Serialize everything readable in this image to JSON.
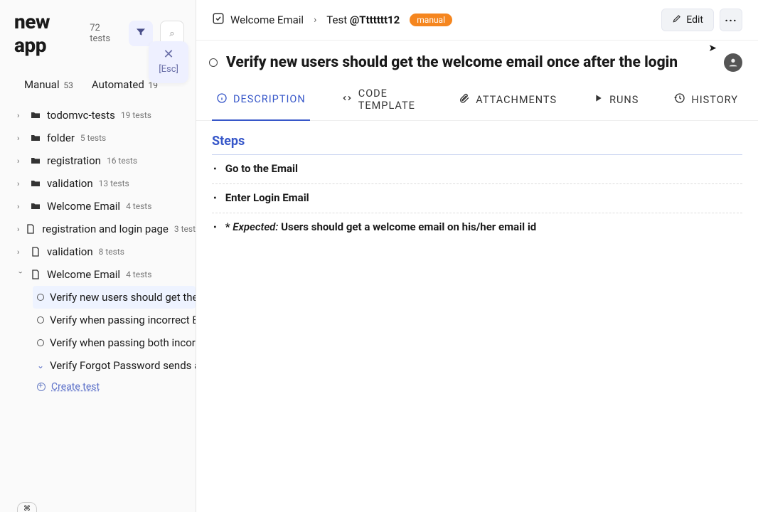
{
  "app": {
    "title": "new app",
    "total_tests_label": "72 tests"
  },
  "esc_popup": {
    "x": "✕",
    "label": "[Esc]"
  },
  "sidebar_tabs": {
    "manual": {
      "label": "Manual",
      "count": "53"
    },
    "automated": {
      "label": "Automated",
      "count": "19"
    }
  },
  "tree": {
    "items": [
      {
        "type": "folder",
        "label": "todomvc-tests",
        "count": "19 tests"
      },
      {
        "type": "folder",
        "label": "folder",
        "count": "5 tests"
      },
      {
        "type": "folder",
        "label": "registration",
        "count": "16 tests"
      },
      {
        "type": "folder",
        "label": "validation",
        "count": "13 tests"
      },
      {
        "type": "folder",
        "label": "Welcome Email",
        "count": "4 tests"
      },
      {
        "type": "file",
        "label": "registration and login page",
        "count": "3 test"
      },
      {
        "type": "file",
        "label": "validation",
        "count": "8 tests"
      },
      {
        "type": "file",
        "label": "Welcome Email",
        "count": "4 tests",
        "expanded": true
      }
    ],
    "subtests": [
      {
        "label": "Verify new users should get the",
        "active": true
      },
      {
        "label": "Verify when passing incorrect Em"
      },
      {
        "label": "Verify when passing both incorr"
      },
      {
        "label": "Verify Forgot Password sends a ",
        "caret": true
      }
    ],
    "create_label": "Create test"
  },
  "breadcrumb": {
    "parent": "Welcome Email",
    "test_prefix": "Test ",
    "test_id": "@Ttttttt12",
    "badge": "manual"
  },
  "buttons": {
    "edit": "Edit",
    "more": "···"
  },
  "title": "Verify new users should get the welcome email once after the login",
  "tabs": {
    "description": "DESCRIPTION",
    "code": "CODE TEMPLATE",
    "attachments": "ATTACHMENTS",
    "runs": "RUNS",
    "history": "HISTORY"
  },
  "steps": {
    "heading": "Steps",
    "items": [
      {
        "text": "Go to the Email"
      },
      {
        "text": "Enter Login Email"
      },
      {
        "expected_prefix": "* ",
        "expected_label": "Expected:",
        "text": " Users should get a welcome email on his/her email id"
      }
    ]
  }
}
